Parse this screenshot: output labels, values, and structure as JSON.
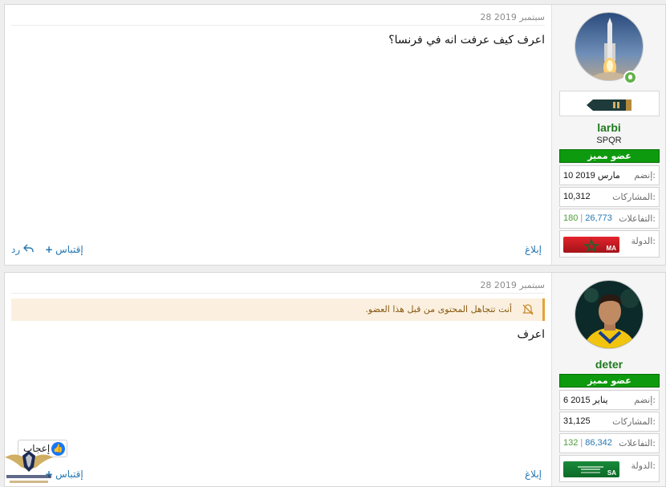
{
  "posts": [
    {
      "date": "28 سبتمبر 2019",
      "text": "اعرف كيف عرفت انه في فرنسا؟",
      "user": {
        "name": "larbi",
        "title": "SPQR",
        "badge": "عضو مميز",
        "joined_label": "إنضم:",
        "joined": "10 مارس 2019",
        "posts_label": "المشاركات:",
        "posts": "10,312",
        "reactions_label": "التفاعلات:",
        "reactions_a": "26,773",
        "reactions_b": "180",
        "country_label": "الدولة:",
        "country_code": "MA",
        "online": true
      }
    },
    {
      "date": "28 سبتمبر 2019",
      "ignored_notice": "أنت تتجاهل المحتوى من قبل هذا العضو.",
      "text": "اعرف",
      "user": {
        "name": "deter",
        "badge": "عضو مميز",
        "joined_label": "إنضم:",
        "joined": "6 يناير 2015",
        "posts_label": "المشاركات:",
        "posts": "31,125",
        "reactions_label": "التفاعلات:",
        "reactions_a": "86,342",
        "reactions_b": "132",
        "country_label": "الدولة:",
        "country_code": "SA"
      }
    }
  ],
  "actions": {
    "report": "إبلاغ",
    "quote": "إقتباس",
    "reply": "رد",
    "like": "إعجاب"
  },
  "colors": {
    "username": "#1f7a1f",
    "badge": "#0e9a0e",
    "link": "#2577b1",
    "ignored_bg": "#fbf0e0",
    "ignored_border": "#e3a33b"
  }
}
